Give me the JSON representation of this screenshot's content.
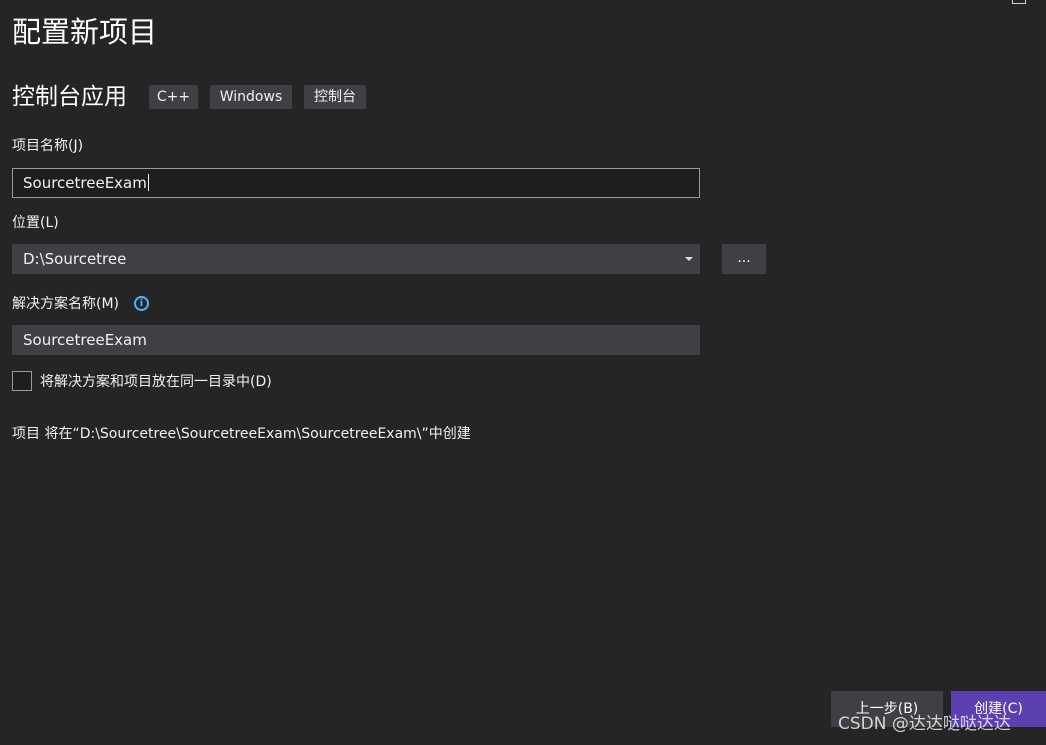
{
  "header": {
    "title": "配置新项目"
  },
  "template": {
    "name": "控制台应用",
    "tags": [
      "C++",
      "Windows",
      "控制台"
    ]
  },
  "form": {
    "project_name": {
      "label": "项目名称(J)",
      "value": "SourcetreeExam"
    },
    "location": {
      "label": "位置(L)",
      "value": "D:\\Sourcetree",
      "browse_label": "..."
    },
    "solution_name": {
      "label": "解决方案名称(M)",
      "value": "SourcetreeExam",
      "info_glyph": "i"
    },
    "same_directory": {
      "label": "将解决方案和项目放在同一目录中(D)",
      "checked": false
    },
    "path_note": "项目 将在“D:\\Sourcetree\\SourcetreeExam\\SourcetreeExam\\”中创建"
  },
  "footer": {
    "back_label": "上一步(B)",
    "create_label": "创建(C)"
  },
  "watermark": "CSDN @达达哒哒达达",
  "colors": {
    "background": "#252526",
    "accent": "#5c3fb0",
    "info": "#4fb3ff"
  }
}
